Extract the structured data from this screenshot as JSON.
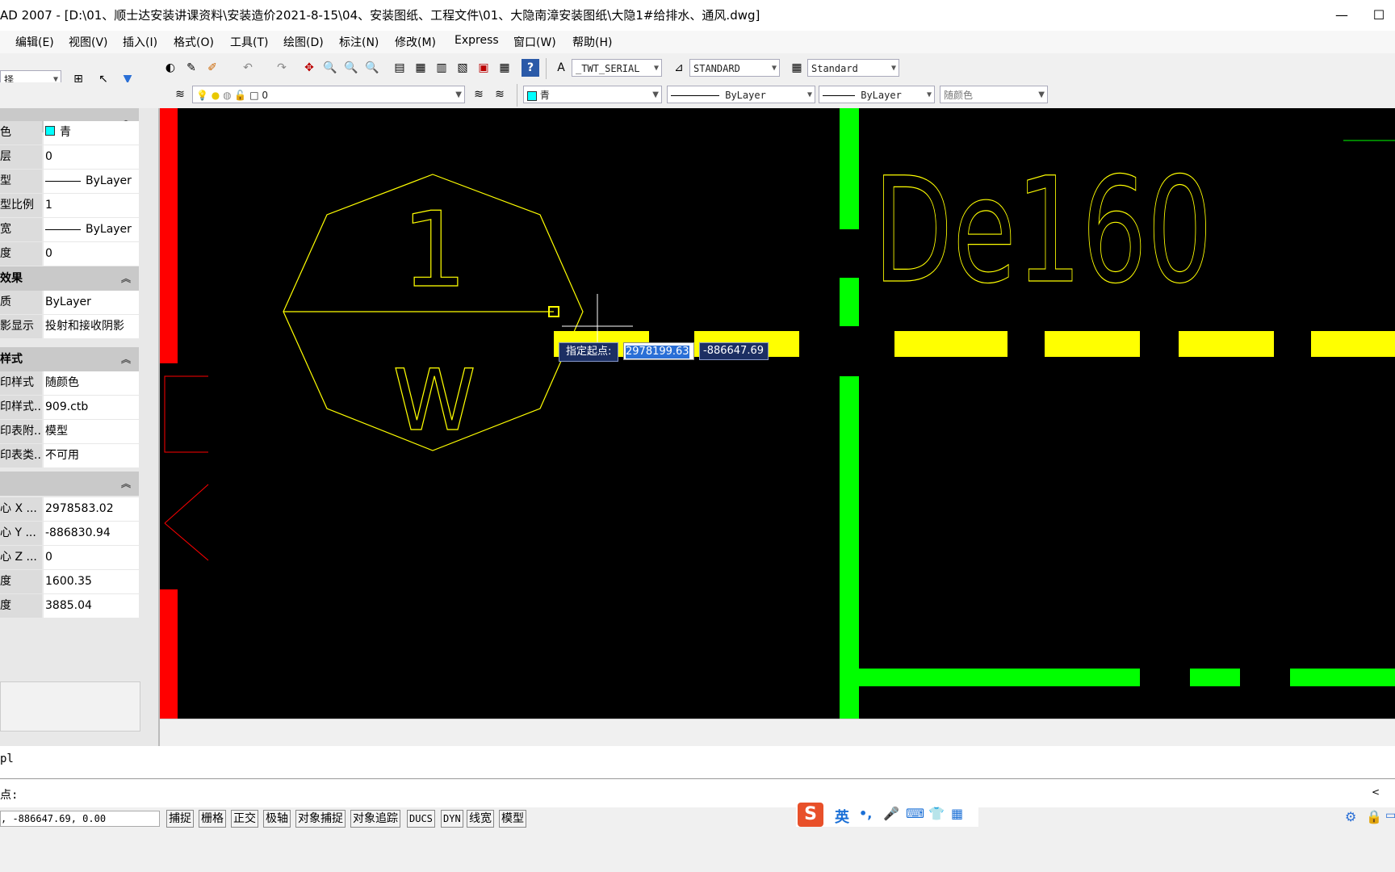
{
  "window": {
    "title": "AD 2007 - [D:\\01、顺士达安装讲课资料\\安装造价2021-8-15\\04、安装图纸、工程文件\\01、大隐南漳安装图纸\\大隐1#给排水、通风.dwg]",
    "minimize": "—",
    "maximize": "☐"
  },
  "menu": [
    "编辑(E)",
    "视图(V)",
    "插入(I)",
    "格式(O)",
    "工具(T)",
    "绘图(D)",
    "标注(N)",
    "修改(M)",
    "Express",
    "窗口(W)",
    "帮助(H)"
  ],
  "toolbar": {
    "selector_value": "择",
    "text_style": "_TWT_SERIAL",
    "dim_style": "STANDARD",
    "table_style": "Standard",
    "layer_value": "0",
    "color_value": "青",
    "linetype_value": "ByLayer",
    "lineweight_value": "ByLayer",
    "plotstyle_value": "随颜色"
  },
  "properties": {
    "general": [
      {
        "key": "色",
        "value": "青"
      },
      {
        "key": "层",
        "value": "0"
      },
      {
        "key": "型",
        "value": "ByLayer"
      },
      {
        "key": "型比例",
        "value": "1"
      },
      {
        "key": "宽",
        "value": "ByLayer"
      },
      {
        "key": "度",
        "value": "0"
      }
    ],
    "effects_title": "效果",
    "effects": [
      {
        "key": "质",
        "value": "ByLayer"
      },
      {
        "key": "影显示",
        "value": "投射和接收阴影"
      }
    ],
    "style_title": "样式",
    "style": [
      {
        "key": "印样式",
        "value": "随颜色"
      },
      {
        "key": "印样式...",
        "value": "909.ctb"
      },
      {
        "key": "印表附...",
        "value": "模型"
      },
      {
        "key": "印表类...",
        "value": "不可用"
      }
    ],
    "view": [
      {
        "key": "心 X ...",
        "value": "2978583.02"
      },
      {
        "key": "心 Y ...",
        "value": "-886830.94"
      },
      {
        "key": "心 Z ...",
        "value": "0"
      },
      {
        "key": "度",
        "value": "1600.35"
      },
      {
        "key": "度",
        "value": "3885.04"
      }
    ]
  },
  "drawing": {
    "symbol_number": "1",
    "symbol_letter": "W",
    "pipe_label": "De160",
    "dyn_prompt": "指定起点:",
    "dyn_x": "2978199.63",
    "dyn_y": "-886647.69"
  },
  "command": {
    "history": "pl",
    "prompt": "点:",
    "scroll_left": "<"
  },
  "status": {
    "coords": ", -886647.69, 0.00",
    "buttons": [
      "捕捉",
      "栅格",
      "正交",
      "极轴",
      "对象捕捉",
      "对象追踪",
      "DUCS",
      "DYN",
      "线宽",
      "模型"
    ]
  },
  "ime": {
    "logo": "S",
    "lang": "英",
    "punct": "•,",
    "mic": "🎤",
    "keyboard": "⌨",
    "skin": "👕",
    "apps": "▦"
  },
  "colors": {
    "yellow": "#ffff00",
    "green": "#00ff00",
    "red": "#ff0000",
    "cyan": "#00ffff",
    "canvas": "#000000"
  }
}
